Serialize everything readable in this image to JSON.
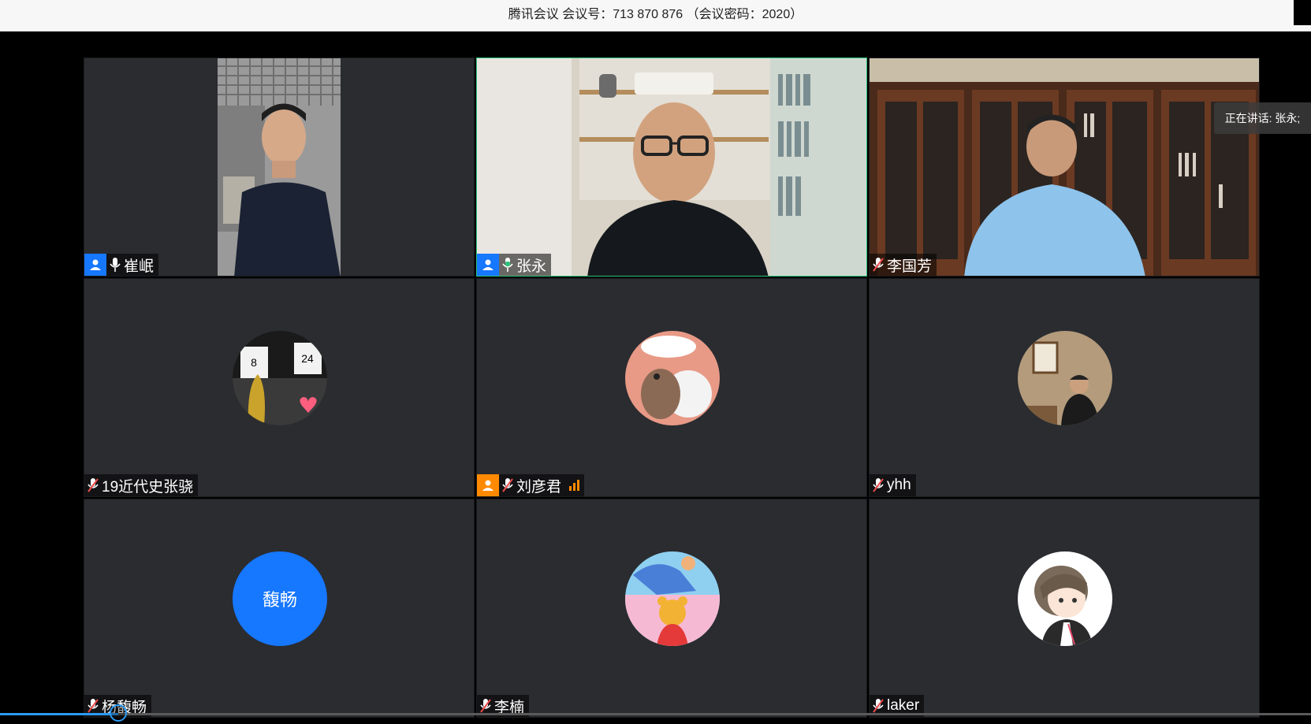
{
  "window": {
    "title": "腾讯会议 会议号：713 870 876 （会议密码：2020）"
  },
  "speaking_indicator": {
    "label": "正在讲话: 张永;"
  },
  "participants": [
    {
      "name": "崔岷",
      "host": true,
      "host_color": "#1677ff",
      "mic": "on",
      "view": "video"
    },
    {
      "name": "张永",
      "host": true,
      "host_color": "#1677ff",
      "mic": "speaking",
      "view": "video",
      "active_speaker": true
    },
    {
      "name": "李国芳",
      "host": false,
      "mic": "muted",
      "view": "video"
    },
    {
      "name": "19近代史张骁",
      "host": false,
      "mic": "muted",
      "view": "avatar"
    },
    {
      "name": "刘彦君",
      "host": true,
      "host_color": "#ff8a00",
      "mic": "muted",
      "view": "avatar",
      "network_signal": true
    },
    {
      "name": "yhh",
      "host": false,
      "mic": "muted",
      "view": "avatar"
    },
    {
      "name": "杨馥畅",
      "host": false,
      "mic": "muted",
      "view": "avatar",
      "avatar_text": "馥畅"
    },
    {
      "name": "李楠",
      "host": false,
      "mic": "muted",
      "view": "avatar"
    },
    {
      "name": "laker",
      "host": false,
      "mic": "muted",
      "view": "avatar"
    }
  ],
  "playback": {
    "progress_fraction": 0.09
  },
  "colors": {
    "speaking_border": "#2dc27a",
    "host_blue": "#1677ff",
    "host_orange": "#ff8a00",
    "avatar_blue": "#1677ff",
    "progress_blue": "#2b9af3"
  }
}
